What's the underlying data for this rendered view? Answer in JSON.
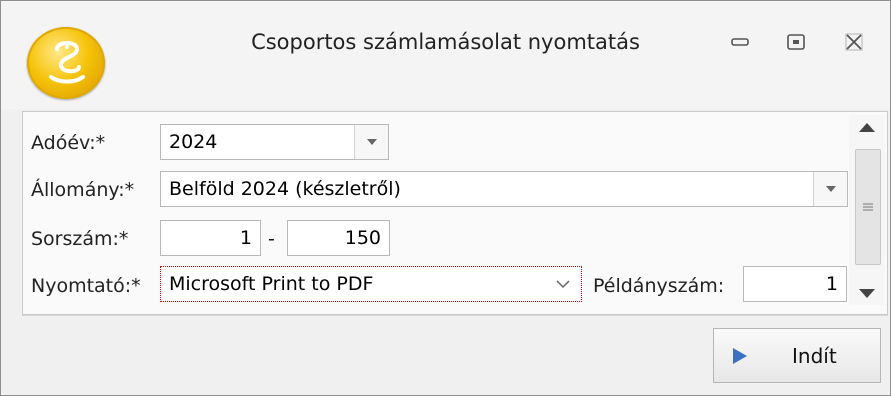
{
  "window": {
    "title": "Csoportos számlamásolat nyomtatás",
    "icon": "snake-logo-icon",
    "controls": [
      "minimize-icon",
      "restore-icon",
      "close-icon"
    ]
  },
  "form": {
    "year_label": "Adóév:*",
    "year_value": "2024",
    "file_label": "Állomány:*",
    "file_value": "Belföld 2024 (készletről)",
    "serial_label": "Sorszám:*",
    "serial_from": "1",
    "serial_separator": "-",
    "serial_to": "150",
    "printer_label": "Nyomtató:*",
    "printer_value": "Microsoft Print to PDF",
    "copies_label": "Példányszám:",
    "copies_value": "1"
  },
  "footer": {
    "start_label": "Indít",
    "start_icon": "play-icon"
  },
  "colors": {
    "accent": "#3b6fc4",
    "logo_gold": "#f6c30a",
    "focus_border": "#d00000"
  }
}
